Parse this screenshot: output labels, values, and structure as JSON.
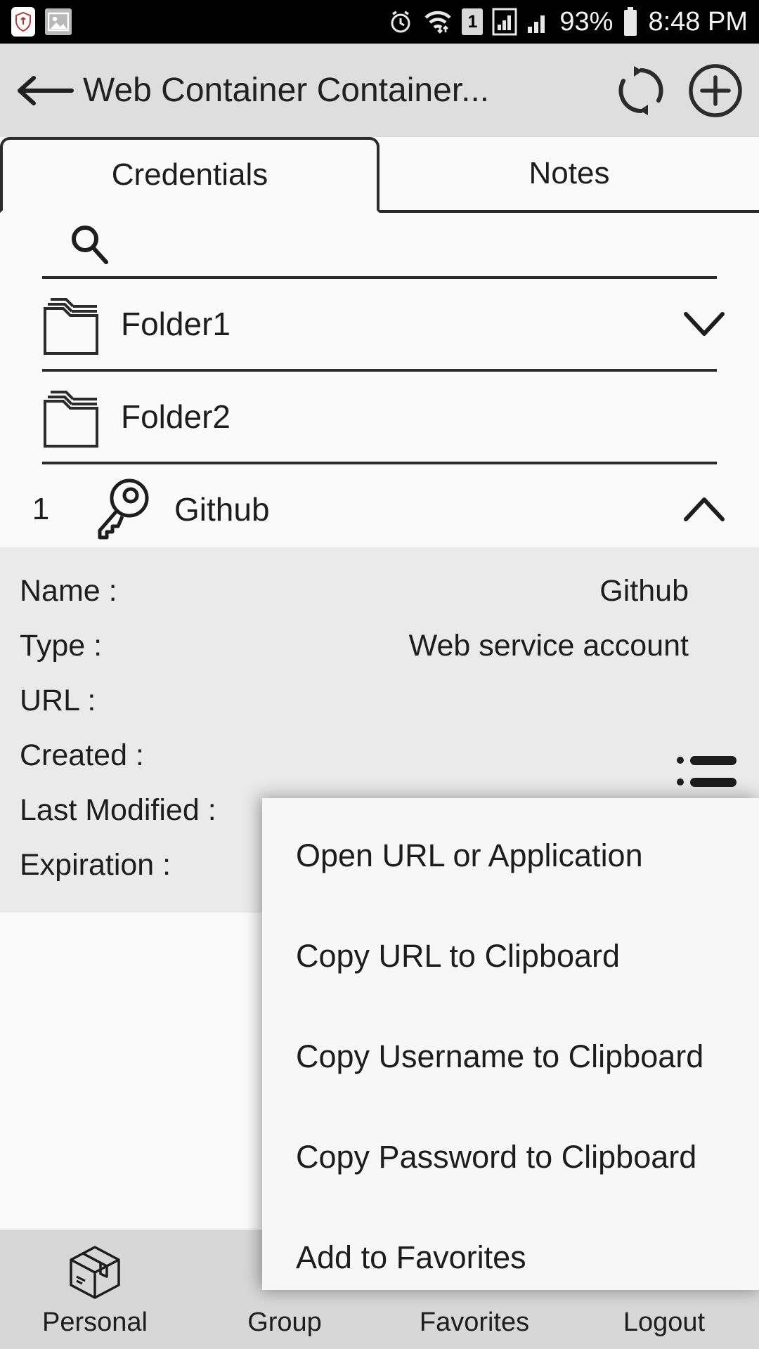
{
  "statusbar": {
    "left_icons": [
      "shield-icon",
      "photo-icon"
    ],
    "right_icons": [
      "alarm-icon",
      "wifi-icon",
      "sim-1-icon",
      "signal-1-icon",
      "signal-2-icon"
    ],
    "sim_badge": "1",
    "battery_percent": "93%",
    "time": "8:48 PM"
  },
  "appbar": {
    "back_label": "back-arrow",
    "title": "Web Container Container...",
    "refresh_label": "refresh",
    "add_label": "add"
  },
  "tabs": [
    {
      "label": "Credentials",
      "active": true
    },
    {
      "label": "Notes",
      "active": false
    }
  ],
  "search": {
    "placeholder": "",
    "value": ""
  },
  "list": [
    {
      "type": "folder",
      "index": "",
      "label": "Folder1",
      "chevron": "down"
    },
    {
      "type": "folder",
      "index": "",
      "label": "Folder2",
      "chevron": "none"
    },
    {
      "type": "credential",
      "index": "1",
      "label": "Github",
      "chevron": "up"
    }
  ],
  "detail": {
    "rows": [
      {
        "key": "Name :",
        "value": "Github"
      },
      {
        "key": "Type :",
        "value": "Web service account"
      },
      {
        "key": "URL :",
        "value": ""
      },
      {
        "key": "Created :",
        "value": ""
      },
      {
        "key": "Last Modified :",
        "value": ""
      },
      {
        "key": "Expiration :",
        "value": ""
      }
    ]
  },
  "popup_menu": {
    "items": [
      "Open URL or Application",
      "Copy URL to Clipboard",
      "Copy Username to Clipboard",
      "Copy Password to Clipboard",
      "Add to Favorites"
    ]
  },
  "bottomnav": [
    {
      "label": "Personal",
      "icon": "box-icon",
      "active": true
    },
    {
      "label": "Group",
      "icon": "group-icon",
      "active": false
    },
    {
      "label": "Favorites",
      "icon": "star-icon",
      "active": false
    },
    {
      "label": "Logout",
      "icon": "logout-icon",
      "active": false
    }
  ],
  "colors": {
    "statusbar_bg": "#000000",
    "appbar_bg": "#dedede",
    "page_bg": "#fafafa",
    "detail_bg": "#eaeaea",
    "bottomnav_bg": "#d7d7d7",
    "popup_bg": "#f7f7f7",
    "text": "#1d1d1d",
    "shield_accent": "#b23c3c"
  }
}
